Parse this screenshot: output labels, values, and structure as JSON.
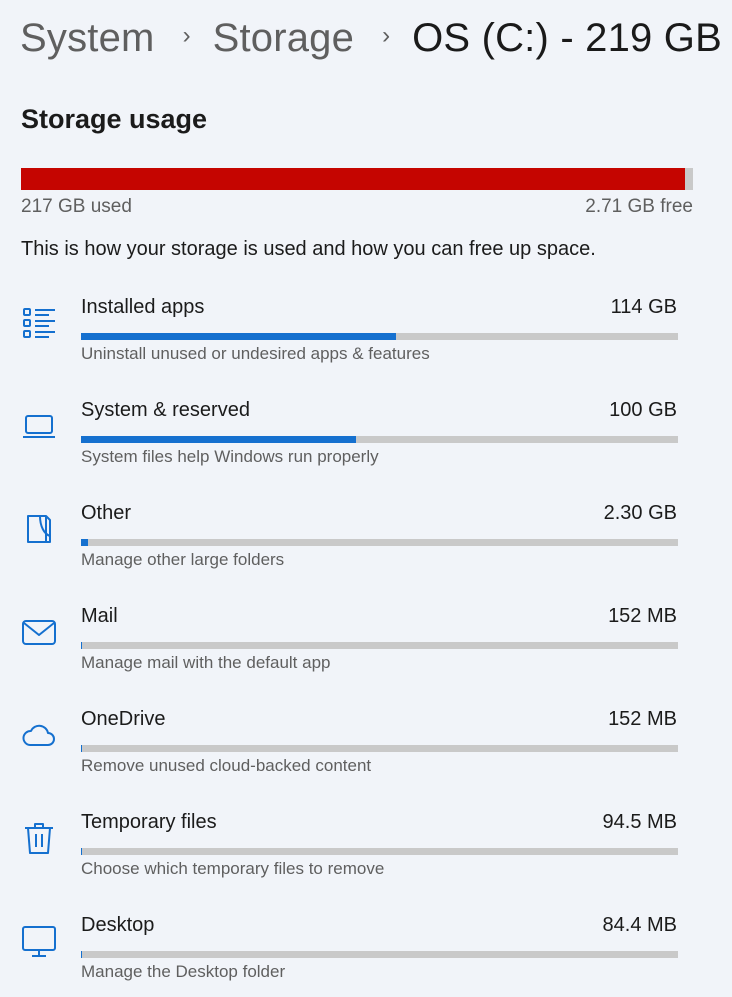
{
  "breadcrumb": {
    "items": [
      "System",
      "Storage",
      "OS (C:) - 219 GB"
    ],
    "separator": "›"
  },
  "storage_usage": {
    "title": "Storage usage",
    "used_label": "217 GB used",
    "free_label": "2.71 GB free",
    "used_fraction": 0.9876,
    "bar_color": "#c50500",
    "description": "This is how your storage is used and how you can free up space."
  },
  "accent_color": "#1570cf",
  "categories": [
    {
      "icon": "list-icon",
      "name": "Installed apps",
      "size": "114 GB",
      "fraction": 0.527,
      "subtitle": "Uninstall unused or undesired apps & features"
    },
    {
      "icon": "laptop-icon",
      "name": "System & reserved",
      "size": "100 GB",
      "fraction": 0.461,
      "subtitle": "System files help Windows run properly"
    },
    {
      "icon": "document-icon",
      "name": "Other",
      "size": "2.30 GB",
      "fraction": 0.011,
      "subtitle": "Manage other large folders"
    },
    {
      "icon": "mail-icon",
      "name": "Mail",
      "size": "152 MB",
      "fraction": 0.0007,
      "subtitle": "Manage mail with the default app"
    },
    {
      "icon": "cloud-icon",
      "name": "OneDrive",
      "size": "152 MB",
      "fraction": 0.0007,
      "subtitle": "Remove unused cloud-backed content"
    },
    {
      "icon": "trash-icon",
      "name": "Temporary files",
      "size": "94.5 MB",
      "fraction": 0.0004,
      "subtitle": "Choose which temporary files to remove"
    },
    {
      "icon": "desktop-icon",
      "name": "Desktop",
      "size": "84.4 MB",
      "fraction": 0.0004,
      "subtitle": "Manage the Desktop folder"
    }
  ]
}
